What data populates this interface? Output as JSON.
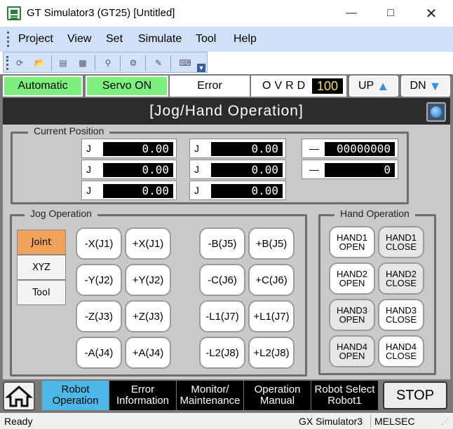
{
  "window": {
    "title": "GT Simulator3 (GT25)  [Untitled]"
  },
  "menu": [
    "Project",
    "View",
    "Set",
    "Simulate",
    "Tool",
    "Help"
  ],
  "status": {
    "mode": "Automatic",
    "servo": "Servo ON",
    "error": "Error",
    "ovrd_label": "OVRD",
    "ovrd_value": "100",
    "up": "UP",
    "dn": "DN"
  },
  "header": {
    "title": "[Jog/Hand Operation]"
  },
  "current_position": {
    "label": "Current Position",
    "col1": [
      {
        "l": "J",
        "v": "0.00"
      },
      {
        "l": "J",
        "v": "0.00"
      },
      {
        "l": "J",
        "v": "0.00"
      }
    ],
    "col2": [
      {
        "l": "J",
        "v": "0.00"
      },
      {
        "l": "J",
        "v": "0.00"
      },
      {
        "l": "J",
        "v": "0.00"
      }
    ],
    "col3": [
      {
        "l": "—",
        "v": "00000000"
      },
      {
        "l": "—",
        "v": "0"
      }
    ]
  },
  "jog": {
    "label": "Jog Operation",
    "modes": [
      "Joint",
      "XYZ",
      "Tool"
    ],
    "buttons": [
      [
        "-X(J1)",
        "+X(J1)",
        "-B(J5)",
        "+B(J5)"
      ],
      [
        "-Y(J2)",
        "+Y(J2)",
        "-C(J6)",
        "+C(J6)"
      ],
      [
        "-Z(J3)",
        "+Z(J3)",
        "-L1(J7)",
        "+L1(J7)"
      ],
      [
        "-A(J4)",
        "+A(J4)",
        "-L2(J8)",
        "+L2(J8)"
      ]
    ]
  },
  "hand": {
    "label": "Hand Operation",
    "rows": [
      {
        "open_a": "HAND1",
        "open_b": "OPEN",
        "close_a": "HAND1",
        "close_b": "CLOSE"
      },
      {
        "open_a": "HAND2",
        "open_b": "OPEN",
        "close_a": "HAND2",
        "close_b": "CLOSE"
      },
      {
        "open_a": "HAND3",
        "open_b": "OPEN",
        "close_a": "HAND3",
        "close_b": "CLOSE"
      },
      {
        "open_a": "HAND4",
        "open_b": "OPEN",
        "close_a": "HAND4",
        "close_b": "CLOSE"
      }
    ]
  },
  "nav": [
    {
      "a": "Robot",
      "b": "Operation"
    },
    {
      "a": "Error",
      "b": "Information"
    },
    {
      "a": "Monitor/",
      "b": "Maintenance"
    },
    {
      "a": "Operation",
      "b": "Manual"
    },
    {
      "a": "Robot Select",
      "b": "Robot1"
    }
  ],
  "stop": "STOP",
  "statusbar": {
    "left": "Ready",
    "app": "GX Simulator3",
    "vendor": "MELSEC"
  },
  "colors": {
    "accent_green": "#7ef07e",
    "active_mode": "#f2a35b",
    "active_nav": "#4cb8e8",
    "ovrd_text": "#f4e04d"
  }
}
